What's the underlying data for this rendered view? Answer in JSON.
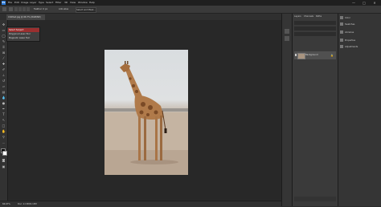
{
  "menubar": {
    "logo": "Ps",
    "items": [
      "File",
      "Edit",
      "Image",
      "Layer",
      "Type",
      "Select",
      "Filter",
      "3D",
      "View",
      "Window",
      "Help"
    ],
    "window_controls": [
      "—",
      "□",
      "✕"
    ]
  },
  "options": {
    "feather_label": "Feather: 0 px",
    "anti_alias": "Anti-alias",
    "select_mask": "Select and Mask..."
  },
  "document": {
    "tab_title": "Untitled.jpg @ 66.7% (RGB/8#)"
  },
  "context_menu": {
    "items": [
      "Select Subject",
      "Polygonal Lasso Tool",
      "Magnetic Lasso Tool"
    ]
  },
  "status": {
    "zoom": "66.67%",
    "doc_info": "Doc: 2.13M/2.13M"
  },
  "layers_panel": {
    "tabs": [
      "Layers",
      "Channels",
      "Paths"
    ],
    "layer_name": "Background",
    "lock_icon": "lock-icon"
  },
  "right_panel": {
    "items": [
      "Color",
      "Swatches",
      "Libraries",
      "Properties",
      "Adjustments"
    ]
  },
  "colors": {
    "accent": "#2b7ad9",
    "menu_highlight": "#9a2f2f"
  }
}
